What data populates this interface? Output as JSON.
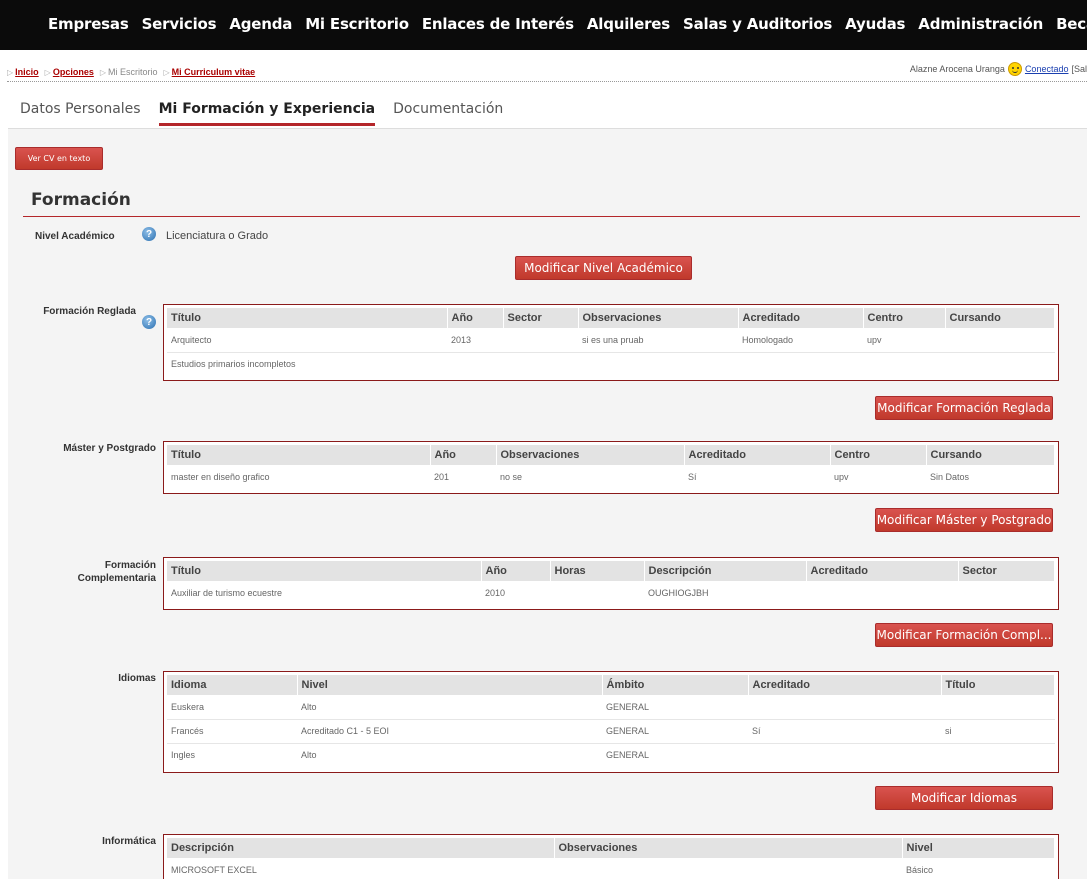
{
  "nav": [
    "Empresas",
    "Servicios",
    "Agenda",
    "Mi Escritorio",
    "Enlaces de Interés",
    "Alquileres",
    "Salas y Auditorios",
    "Ayudas",
    "Administración",
    "Becas"
  ],
  "breadcrumb": {
    "inicio": "Inicio",
    "opciones": "Opciones",
    "escritorio": "Mi Escritorio",
    "cv": "Mi Curriculum vitae"
  },
  "user": {
    "name": "Alazne Arocena Uranga",
    "status": "Conectado",
    "exit": "[Sal"
  },
  "tabs": [
    "Datos Personales",
    "Mi Formación y Experiencia",
    "Documentación"
  ],
  "ver_cv": "Ver CV en texto",
  "section_title": "Formación",
  "nivel": {
    "label": "Nivel Académico",
    "value": "Licenciatura o Grado",
    "button": "Modificar Nivel Académico"
  },
  "reglada": {
    "label": "Formación Reglada",
    "headers": [
      "Título",
      "Año",
      "Sector",
      "Observaciones",
      "Acreditado",
      "Centro",
      "Cursando"
    ],
    "rows": [
      [
        "Arquitecto",
        "2013",
        "",
        "si es una pruab",
        "Homologado",
        "upv",
        ""
      ],
      [
        "Estudios primarios incompletos",
        "",
        "",
        "",
        "",
        "",
        ""
      ]
    ],
    "button": "Modificar Formación Reglada"
  },
  "master": {
    "label": "Máster y Postgrado",
    "headers": [
      "Título",
      "Año",
      "Observaciones",
      "Acreditado",
      "Centro",
      "Cursando"
    ],
    "rows": [
      [
        "master en diseño grafico",
        "201",
        "no se",
        "Sí",
        "upv",
        "Sin Datos"
      ]
    ],
    "button": "Modificar Máster y Postgrado"
  },
  "complementaria": {
    "label_1": "Formación",
    "label_2": "Complementaria",
    "headers": [
      "Título",
      "Año",
      "Horas",
      "Descripción",
      "Acreditado",
      "Sector"
    ],
    "rows": [
      [
        "Auxiliar de turismo ecuestre",
        "2010",
        "",
        "OUGHIOGJBH",
        "",
        ""
      ]
    ],
    "button": "Modificar Formación Compl..."
  },
  "idiomas": {
    "label": "Idiomas",
    "headers": [
      "Idioma",
      "Nivel",
      "Ámbito",
      "Acreditado",
      "Título"
    ],
    "rows": [
      [
        "Euskera",
        "Alto",
        "GENERAL",
        "",
        ""
      ],
      [
        "Francés",
        "Acreditado C1 - 5 EOI",
        "GENERAL",
        "Sí",
        "si"
      ],
      [
        "Ingles",
        "Alto",
        "GENERAL",
        "",
        ""
      ]
    ],
    "button": "Modificar Idiomas"
  },
  "informatica": {
    "label": "Informática",
    "headers": [
      "Descripción",
      "Observaciones",
      "Nivel"
    ],
    "rows": [
      [
        "MICROSOFT EXCEL",
        "",
        "Básico"
      ]
    ]
  },
  "colors": {
    "accent": "#b4262a",
    "nav_bg": "#0b0b0b",
    "panel_bg": "#f4f4f4"
  }
}
